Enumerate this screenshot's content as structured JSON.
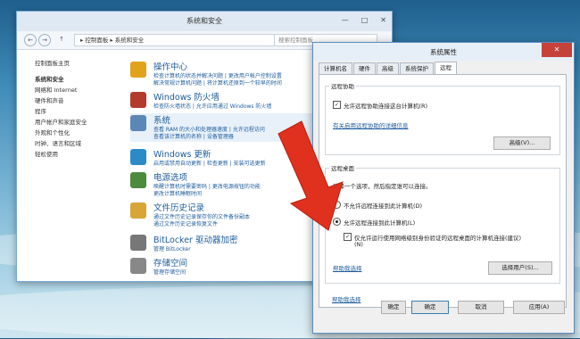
{
  "control_panel": {
    "title": "系统和安全",
    "min": "—",
    "max": "□",
    "close": "✕",
    "nav": {
      "back": "←",
      "forward": "→",
      "up": "↑"
    },
    "breadcrumb": "▸ 控制面板 ▸ 系统和安全",
    "search_placeholder": "搜索控制面板",
    "sidebar": [
      "控制面板主页",
      "系统和安全",
      "网络和 Internet",
      "硬件和声音",
      "程序",
      "用户帐户和家庭安全",
      "外观和个性化",
      "时钟、语言和区域",
      "轻松使用"
    ],
    "sections": [
      {
        "title": "操作中心",
        "lines": [
          "检查计算机的状态并解决问题 | 更改用户帐户控制设置",
          "解决常规计算机问题 | 将计算机还原到一个较早的时间"
        ],
        "color": "#e2a21b"
      },
      {
        "title": "Windows 防火墙",
        "lines": [
          "检查防火墙状态 | 允许应用通过 Windows 防火墙"
        ],
        "color": "#b33a2c"
      },
      {
        "title": "系统",
        "lines": [
          "查看 RAM 的大小和处理器速度 | 允许远程访问",
          "查看该计算机的名称 | 设备管理器"
        ],
        "color": "#5a87b5"
      },
      {
        "title": "Windows 更新",
        "lines": [
          "启用或禁用自动更新 | 检查更新 | 安装可选更新"
        ],
        "color": "#2d8ac9"
      },
      {
        "title": "电源选项",
        "lines": [
          "唤醒计算机时需要密码 | 更改电源按钮的功能",
          "更改计算机睡眠时间"
        ],
        "color": "#4b8b3b"
      },
      {
        "title": "文件历史记录",
        "lines": [
          "通过文件历史记录保存你的文件备份副本",
          "通过文件历史记录恢复文件"
        ],
        "color": "#d8a637"
      },
      {
        "title": "BitLocker 驱动器加密",
        "lines": [
          "管理 BitLocker"
        ],
        "color": "#777777"
      },
      {
        "title": "存储空间",
        "lines": [
          "管理存储空间"
        ],
        "color": "#888888"
      }
    ],
    "bottom_button": "确"
  },
  "dialog": {
    "title": "系统属性",
    "close": "✕",
    "tabs": [
      "计算机名",
      "硬件",
      "高级",
      "系统保护",
      "远程"
    ],
    "remote_assistance": {
      "group_label": "远程协助",
      "checkbox_label": "允许远程协助连接这台计算机(R)",
      "checked": true,
      "link": "有关启用远程协助的详细信息",
      "advanced_button": "高级(V)..."
    },
    "remote_desktop": {
      "group_label": "远程桌面",
      "instruction": "选择一个选项，然后指定谁可以连接。",
      "option_deny": "不允许远程连接到此计算机(D)",
      "option_allow": "允许远程连接到此计算机(L)",
      "selected": "allow",
      "nla_label": "仅允许运行使用网络级别身份验证的远程桌面的计算机连接(建议)",
      "nla_label_2": "(N)",
      "nla_checked": true,
      "help_link": "帮助我选择",
      "select_users_button": "选择用户(S)..."
    },
    "buttons": {
      "ok": "确定",
      "cancel": "取消",
      "apply": "应用(A)"
    },
    "behind_ok": "确定"
  },
  "colors": {
    "arrow": "#e0301e",
    "link": "#1e5c9b",
    "titlebar": "#e6eff7"
  }
}
